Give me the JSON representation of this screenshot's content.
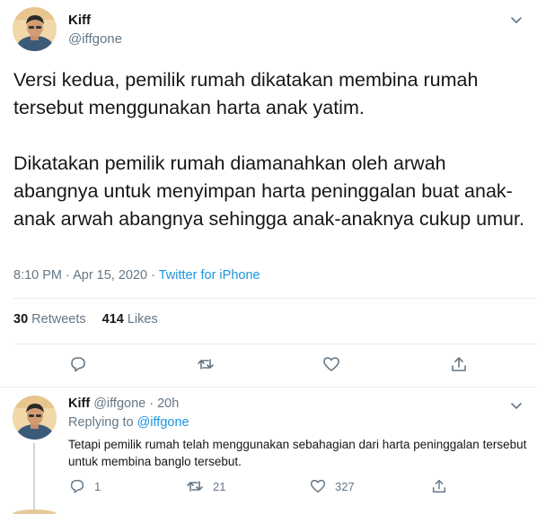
{
  "main_tweet": {
    "name": "Kiff",
    "handle": "@iffgone",
    "text": "Versi kedua, pemilik rumah dikatakan membina rumah tersebut menggunakan harta anak yatim.\n\nDikatakan pemilik rumah diamanahkan oleh arwah abangnya untuk menyimpan harta peninggalan buat anak-anak arwah abangnya sehingga anak-anaknya cukup umur.",
    "time": "8:10 PM · Apr 15, 2020 · ",
    "source": "Twitter for iPhone",
    "retweets_count": "30",
    "retweets_label": "Retweets",
    "likes_count": "414",
    "likes_label": "Likes",
    "icons": [
      "reply-icon",
      "retweet-icon",
      "like-icon",
      "share-icon",
      "chevron-down-icon"
    ]
  },
  "reply_tweet": {
    "name": "Kiff",
    "handle": "@iffgone",
    "time": "· 20h",
    "replying_label": "Replying to ",
    "replying_to": "@iffgone",
    "text": "Tetapi pemilik rumah telah menggunakan sebahagian dari harta peninggalan tersebut untuk membina banglo tersebut.",
    "reply_count": "1",
    "retweet_count": "21",
    "like_count": "327"
  },
  "colors": {
    "text": "#14171a",
    "secondary": "#657786",
    "link": "#1b95e0",
    "divider": "#e6ecf0"
  }
}
